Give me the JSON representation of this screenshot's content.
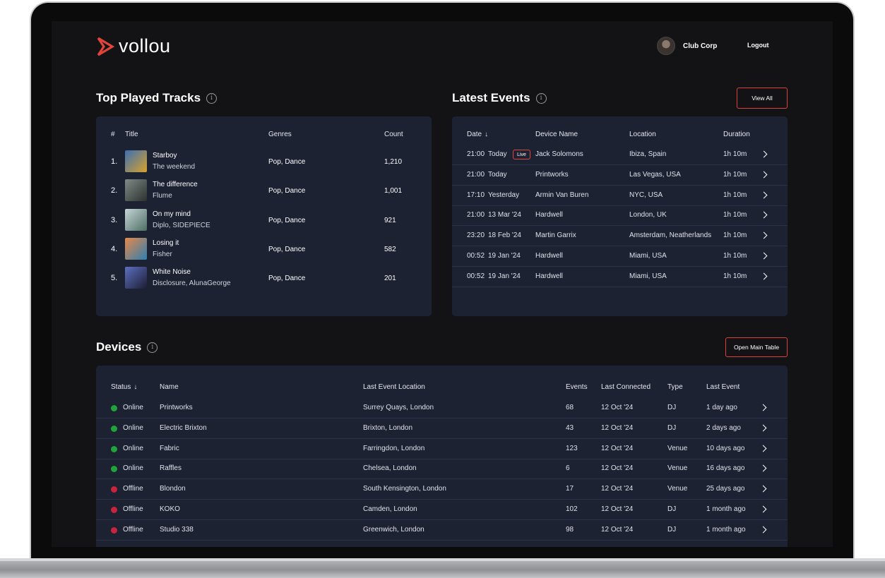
{
  "app": {
    "name": "vollou"
  },
  "header": {
    "user_name": "Club Corp",
    "logout_label": "Logout"
  },
  "colors": {
    "accent": "#e0443b",
    "online": "#1fa33a",
    "offline": "#c8243c",
    "card": "#1d2233",
    "background": "#131315"
  },
  "top_tracks": {
    "title": "Top Played Tracks",
    "columns": [
      "#",
      "Title",
      "Genres",
      "Count"
    ],
    "rows": [
      {
        "num": "1.",
        "title": "Starboy",
        "artist": "The weekend",
        "genres": "Pop, Dance",
        "count": "1,210",
        "art": [
          "#3b6fb3",
          "#d8a22c"
        ]
      },
      {
        "num": "2.",
        "title": "The difference",
        "artist": "Flume",
        "genres": "Pop, Dance",
        "count": "1,001",
        "art": [
          "#7f8a86",
          "#2b3130"
        ]
      },
      {
        "num": "3.",
        "title": "On my mind",
        "artist": "Diplo, SIDEPIECE",
        "genres": "Pop, Dance",
        "count": "921",
        "art": [
          "#c7d5d8",
          "#4c6e63"
        ]
      },
      {
        "num": "4.",
        "title": "Losing it",
        "artist": "Fisher",
        "genres": "Pop, Dance",
        "count": "582",
        "art": [
          "#e7884a",
          "#2f7fb1"
        ]
      },
      {
        "num": "5.",
        "title": "White Noise",
        "artist": "Disclosure, AlunaGeorge",
        "genres": "Pop, Dance",
        "count": "201",
        "art": [
          "#5d6fc0",
          "#1c1d33"
        ]
      }
    ]
  },
  "latest_events": {
    "title": "Latest Events",
    "view_all_label": "View All",
    "columns": [
      "Date",
      "Device Name",
      "Location",
      "Duration"
    ],
    "sort_arrow": "↓",
    "live_label": "Live",
    "rows": [
      {
        "time": "21:00",
        "day": "Today",
        "live": true,
        "device": "Jack Solomons",
        "location": "Ibiza, Spain",
        "duration": "1h 10m"
      },
      {
        "time": "21:00",
        "day": "Today",
        "live": false,
        "device": "Printworks",
        "location": "Las Vegas, USA",
        "duration": "1h 10m"
      },
      {
        "time": "17:10",
        "day": "Yesterday",
        "live": false,
        "device": "Armin Van Buren",
        "location": "NYC, USA",
        "duration": "1h 10m"
      },
      {
        "time": "21:00",
        "day": "13 Mar '24",
        "live": false,
        "device": "Hardwell",
        "location": "London, UK",
        "duration": "1h 10m"
      },
      {
        "time": "23:20",
        "day": "18 Feb '24",
        "live": false,
        "device": "Martin Garrix",
        "location": "Amsterdam, Neatherlands",
        "duration": "1h 10m"
      },
      {
        "time": "00:52",
        "day": "19 Jan '24",
        "live": false,
        "device": "Hardwell",
        "location": "Miami, USA",
        "duration": "1h 10m"
      },
      {
        "time": "00:52",
        "day": "19 Jan '24",
        "live": false,
        "device": "Hardwell",
        "location": "Miami, USA",
        "duration": "1h 10m"
      }
    ]
  },
  "devices": {
    "title": "Devices",
    "open_table_label": "Open Main Table",
    "columns": [
      "Status",
      "Name",
      "Last Event Location",
      "Events",
      "Last Connected",
      "Type",
      "Last Event"
    ],
    "sort_arrow": "↓",
    "rows": [
      {
        "status": "Online",
        "name": "Printworks",
        "location": "Surrey Quays, London",
        "events": "68",
        "connected": "12 Oct '24",
        "type": "DJ",
        "last_event": "1 day ago"
      },
      {
        "status": "Online",
        "name": "Electric Brixton",
        "location": "Brixton, London",
        "events": "43",
        "connected": "12 Oct '24",
        "type": "DJ",
        "last_event": "2 days ago"
      },
      {
        "status": "Online",
        "name": "Fabric",
        "location": "Farringdon, London",
        "events": "123",
        "connected": "12 Oct '24",
        "type": "Venue",
        "last_event": "10 days ago"
      },
      {
        "status": "Online",
        "name": "Raffles",
        "location": "Chelsea, London",
        "events": "6",
        "connected": "12 Oct '24",
        "type": "Venue",
        "last_event": "16 days ago"
      },
      {
        "status": "Offline",
        "name": "Blondon",
        "location": "South Kensington, London",
        "events": "17",
        "connected": "12 Oct '24",
        "type": "Venue",
        "last_event": "25 days ago"
      },
      {
        "status": "Offline",
        "name": "KOKO",
        "location": "Camden, London",
        "events": "102",
        "connected": "12 Oct '24",
        "type": "DJ",
        "last_event": "1 month ago"
      },
      {
        "status": "Offline",
        "name": "Studio 338",
        "location": "Greenwich, London",
        "events": "98",
        "connected": "12 Oct '24",
        "type": "DJ",
        "last_event": "1 month ago"
      }
    ]
  }
}
